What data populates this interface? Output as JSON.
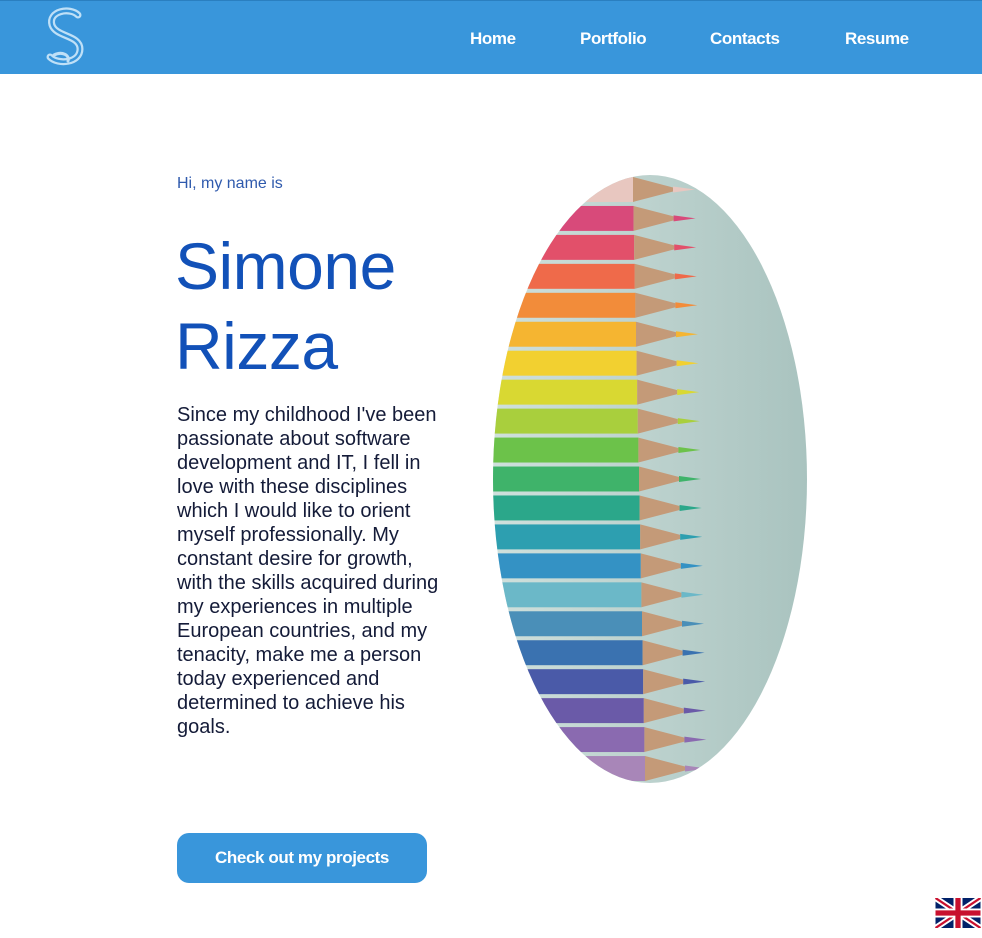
{
  "nav": {
    "items": [
      {
        "label": "Home"
      },
      {
        "label": "Portfolio"
      },
      {
        "label": "Contacts"
      },
      {
        "label": "Resume"
      }
    ]
  },
  "hero": {
    "greeting": "Hi, my name is",
    "first_name": "Simone",
    "last_name": "Rizza",
    "bio": "Since my childhood I've been passionate about software development and IT, I fell in love with these disciplines which I would like to orient myself professionally. My constant desire for growth, with the skills acquired during my experiences in multiple European countries, and my tenacity, make me a person today experienced and determined to achieve his goals.",
    "cta_label": "Check out my projects"
  },
  "icons": {
    "logo": "s-logo-icon",
    "language": "uk-flag-icon"
  },
  "colors": {
    "primary": "#3996db",
    "heading": "#1251b8",
    "greeting": "#2f5aad",
    "body_text": "#141b38"
  }
}
